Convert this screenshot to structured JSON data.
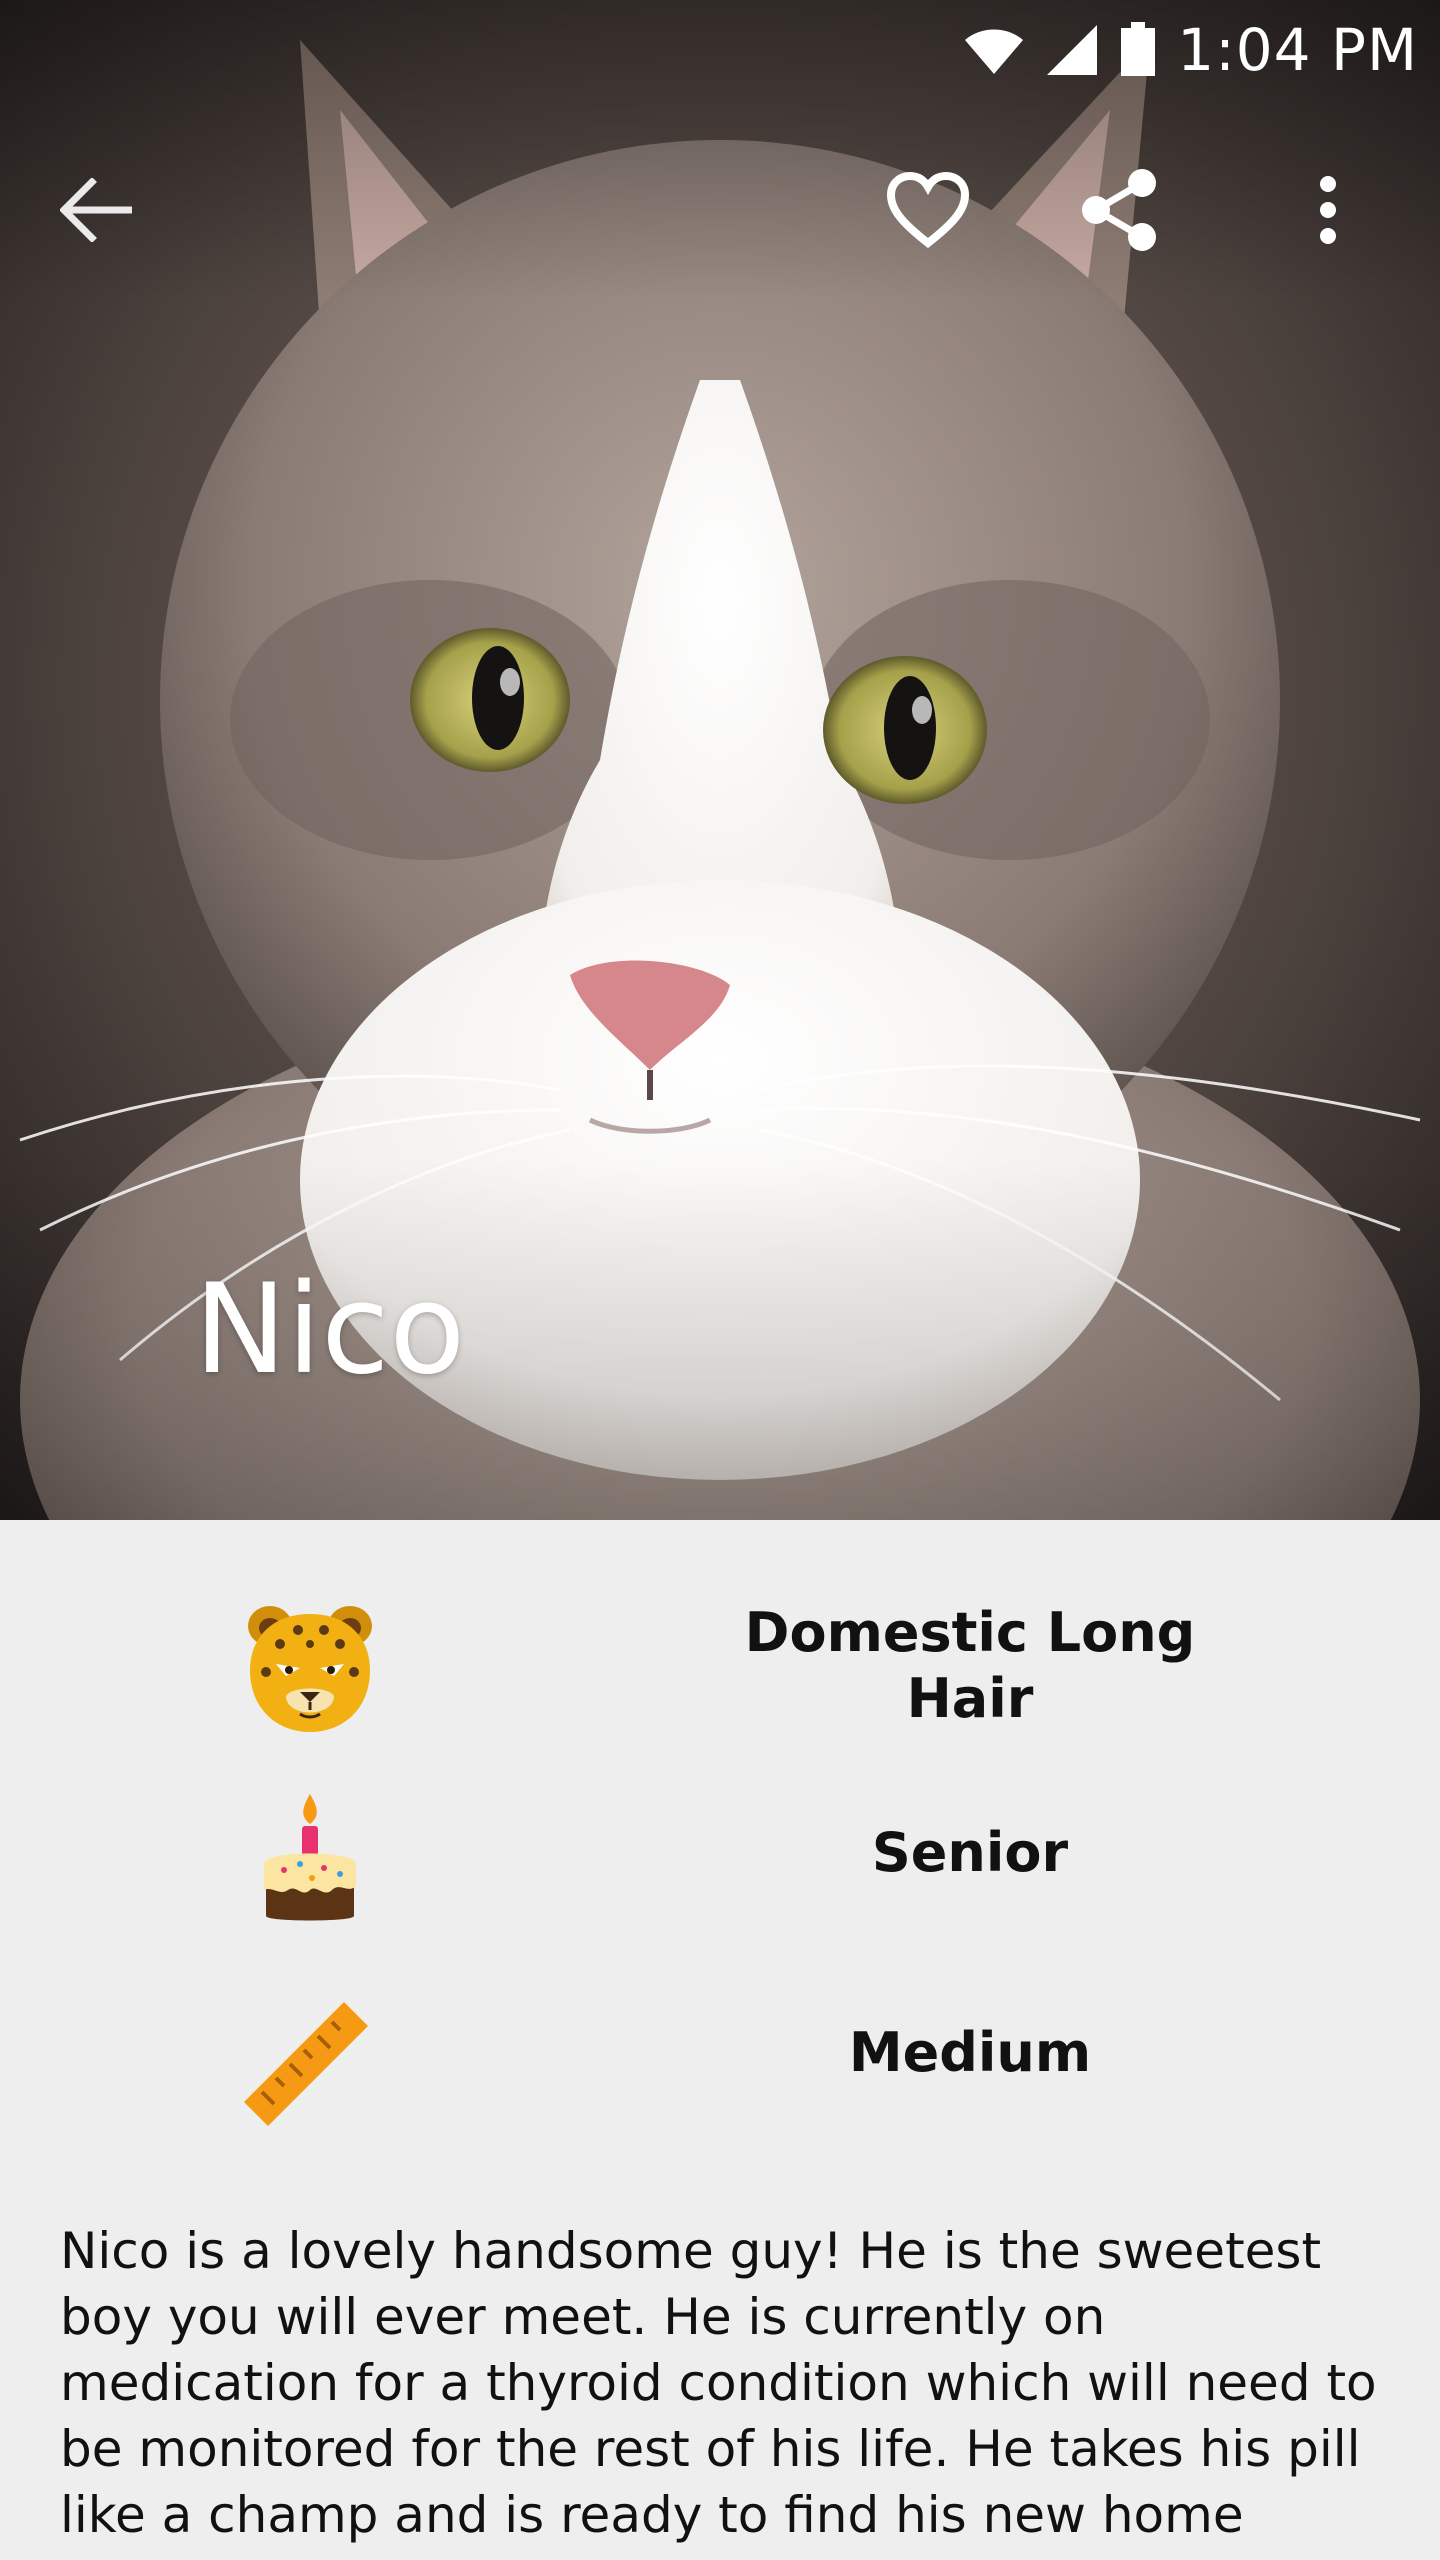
{
  "status_bar": {
    "time": "1:04 PM",
    "icons": [
      "wifi-icon",
      "cell-signal-icon",
      "battery-icon"
    ]
  },
  "toolbar": {
    "back_icon": "arrow-left-icon",
    "favorite_icon": "heart-outline-icon",
    "share_icon": "share-icon",
    "more_icon": "more-vertical-icon"
  },
  "pet": {
    "name": "Nico",
    "photo_icon": "cat-photo"
  },
  "attributes": [
    {
      "icon": "leopard-face-icon",
      "label": "Domestic Long Hair"
    },
    {
      "icon": "birthday-cake-icon",
      "label": "Senior"
    },
    {
      "icon": "ruler-icon",
      "label": "Medium"
    }
  ],
  "description": "Nico is a lovely handsome guy! He is the sweetest boy you will ever meet. He is currently on medication for a thyroid condition which will need to be monitored for the rest of his life. He takes his pill like a champ and is ready to find his new home",
  "colors": {
    "background": "#eeeeee",
    "text": "#111111",
    "toolbar_icons": "#ffffff",
    "leopard_face": "#f2b013",
    "ruler": "#f59a12"
  }
}
